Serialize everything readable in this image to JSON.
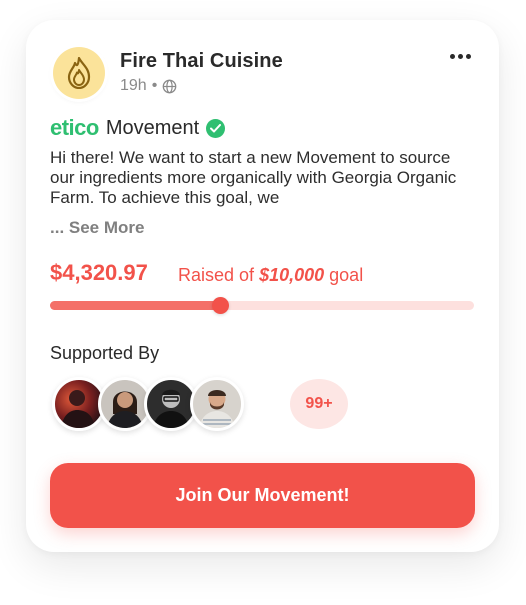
{
  "post": {
    "business_name": "Fire Thai Cuisine",
    "time_ago": "19h",
    "separator": "•",
    "visibility_icon": "globe-icon",
    "logo_icon": "flame-icon",
    "more_icon": "more-horizontal-icon"
  },
  "movement": {
    "brand": "etico",
    "label": "Movement",
    "verified_icon": "verified-check-icon",
    "description": "Hi there! We want to start a new Movement to source our ingredients more organically with Georgia Organic Farm. To achieve this goal, we",
    "see_more": "... See More"
  },
  "funding": {
    "raised": "$4,320.97",
    "goal_prefix": "Raised of",
    "goal_amount": "$10,000",
    "goal_suffix": "goal",
    "progress_fraction": 0.4
  },
  "supporters": {
    "heading": "Supported By",
    "avatars": [
      "supporter-avatar-1",
      "supporter-avatar-2",
      "supporter-avatar-3",
      "supporter-avatar-4"
    ],
    "more_count": "99+"
  },
  "cta": {
    "label": "Join Our Movement!"
  },
  "colors": {
    "accent": "#f2524a",
    "brand_green": "#2fbf71",
    "logo_bg": "#fbe39a",
    "track": "#fde0de"
  }
}
